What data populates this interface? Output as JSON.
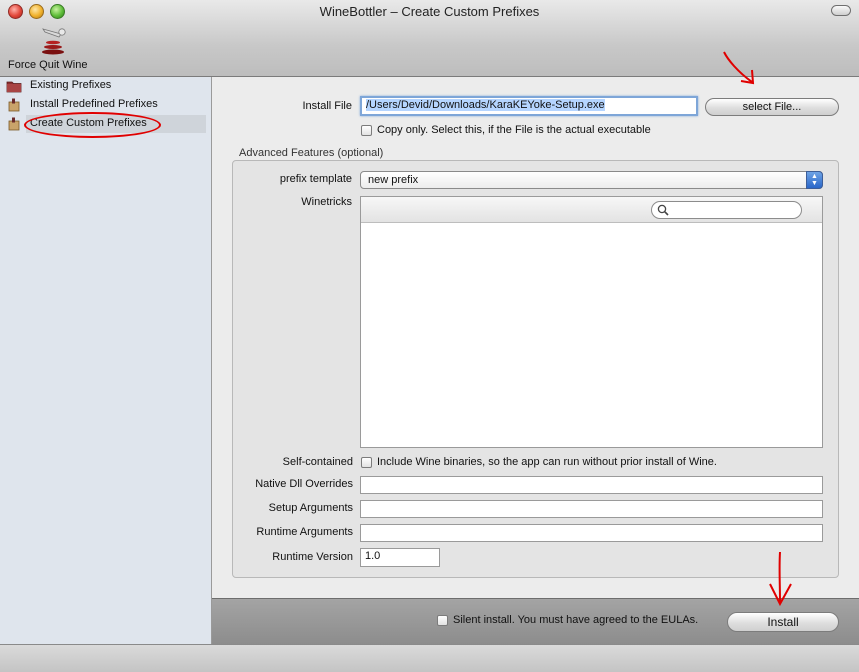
{
  "window": {
    "title": "WineBottler – Create Custom Prefixes"
  },
  "toolbar": {
    "force_quit_label": "Force Quit Wine"
  },
  "sidebar": {
    "items": [
      {
        "label": "Existing Prefixes"
      },
      {
        "label": "Install Predefined Prefixes"
      },
      {
        "label": "Create Custom Prefixes",
        "selected": true
      }
    ]
  },
  "form": {
    "install_file_label": "Install File",
    "install_file_value": "/Users/Devid/Downloads/KaraKEYoke-Setup.exe",
    "select_file_button": "select File...",
    "copy_only_label": "Copy only. Select this, if the File is the actual executable",
    "advanced_title": "Advanced Features (optional)",
    "prefix_template_label": "prefix template",
    "prefix_template_value": "new prefix",
    "winetricks_label": "Winetricks",
    "self_contained_label": "Self-contained",
    "self_contained_checkbox_label": "Include Wine binaries, so the app can run without prior install of Wine.",
    "native_dll_label": "Native Dll Overrides",
    "setup_args_label": "Setup Arguments",
    "runtime_args_label": "Runtime Arguments",
    "runtime_version_label": "Runtime Version",
    "runtime_version_value": "1.0"
  },
  "bottom": {
    "silent_install_label": "Silent install. You must have agreed to the EULAs.",
    "install_button": "Install"
  },
  "colors": {
    "annotation_red": "#e00000",
    "selection_highlight": "#b5d5ff",
    "sidebar_bg": "#dfe5ed"
  }
}
